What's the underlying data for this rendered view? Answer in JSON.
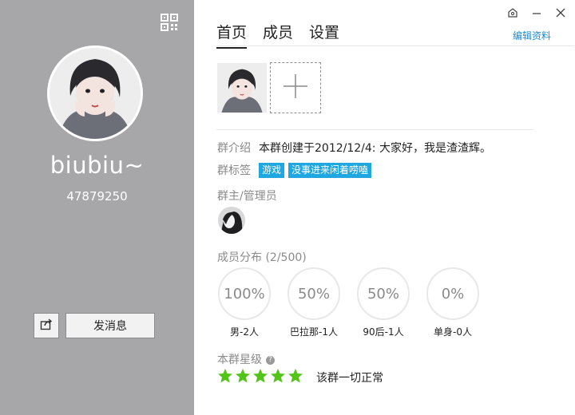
{
  "left": {
    "name": "biubiu~",
    "id": "47879250",
    "send_message": "发消息",
    "qr_icon": "qr-code-icon",
    "share_icon": "share-icon"
  },
  "window": {
    "icons": [
      "skin-icon",
      "minimize-icon",
      "close-icon"
    ]
  },
  "tabs": [
    {
      "label": "首页",
      "active": true
    },
    {
      "label": "成员",
      "active": false
    },
    {
      "label": "设置",
      "active": false
    }
  ],
  "edit_profile": "编辑资料",
  "intro": {
    "label": "群介绍",
    "value": "本群创建于2012/12/4:  大家好，我是渣渣辉。"
  },
  "tags": {
    "label": "群标签",
    "items": [
      "游戏",
      "没事进来闲着唠嗑"
    ]
  },
  "admins": {
    "label": "群主/管理员"
  },
  "members": {
    "label": "成员分布",
    "count": "(2/500)",
    "stats": [
      {
        "percent": "100%",
        "label": "男-2人"
      },
      {
        "percent": "50%",
        "label": "巴拉那-1人"
      },
      {
        "percent": "50%",
        "label": "90后-1人"
      },
      {
        "percent": "0%",
        "label": "单身-0人"
      }
    ]
  },
  "rating": {
    "label": "本群星级",
    "stars": 5,
    "text": "该群一切正常",
    "star_color": "#52c41a"
  },
  "colors": {
    "accent": "#1d8ad2",
    "tag": "#1fa7e1",
    "sidebar": "#a7a7aa"
  }
}
